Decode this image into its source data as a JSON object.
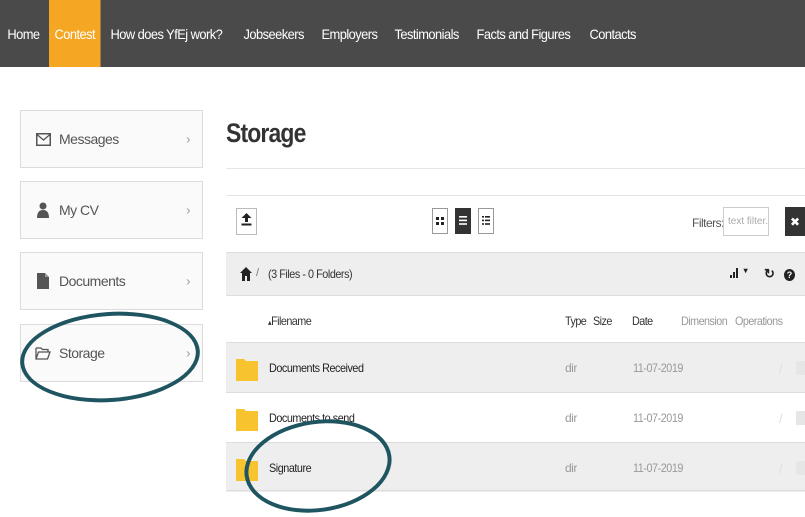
{
  "nav": {
    "items": [
      {
        "label": "Home",
        "active": false
      },
      {
        "label": "Contest",
        "active": true
      },
      {
        "label": "How does YfEj work?",
        "active": false
      },
      {
        "label": "Jobseekers",
        "active": false
      },
      {
        "label": "Employers",
        "active": false
      },
      {
        "label": "Testimonials",
        "active": false
      },
      {
        "label": "Facts and Figures",
        "active": false
      },
      {
        "label": "Contacts",
        "active": false
      }
    ],
    "active_color": "#f5a623",
    "bar_color": "#4a4a4a"
  },
  "sidebar": {
    "items": [
      {
        "label": "Messages",
        "icon": "envelope-icon",
        "chevron": "›"
      },
      {
        "label": "My CV",
        "icon": "user-icon",
        "chevron": "›"
      },
      {
        "label": "Documents",
        "icon": "document-icon",
        "chevron": "›"
      },
      {
        "label": "Storage",
        "icon": "folder-open-icon",
        "chevron": "›"
      }
    ]
  },
  "main": {
    "title": "Storage",
    "toolbar": {
      "upload_icon": "upload-icon",
      "view_modes": [
        "grid-view-icon",
        "list-view-icon",
        "detail-view-icon"
      ],
      "active_view": "list-view-icon",
      "filters_label": "Filters:",
      "filter_placeholder": "text filter...",
      "clear_label": "✖"
    },
    "path": {
      "separator": "/",
      "info": "(3 Files - 0 Folders)",
      "sort_icon": "▾",
      "refresh_icon": "↻",
      "help_icon": "?"
    },
    "table": {
      "headers": {
        "filename": "Filename",
        "sort_marker": "▴",
        "type": "Type",
        "size": "Size",
        "date": "Date",
        "dimension": "Dimension",
        "operations": "Operations"
      },
      "rows": [
        {
          "name": "Documents Received",
          "type": "dir",
          "date": "11-07-2019",
          "edit": "/"
        },
        {
          "name": "Documents to send",
          "type": "dir",
          "date": "11-07-2019",
          "edit": "/"
        },
        {
          "name": "Signature",
          "type": "dir",
          "date": "11-07-2019",
          "edit": "/"
        }
      ]
    }
  },
  "annotation_color": "#1f5560",
  "folder_color": "#f7c32e"
}
